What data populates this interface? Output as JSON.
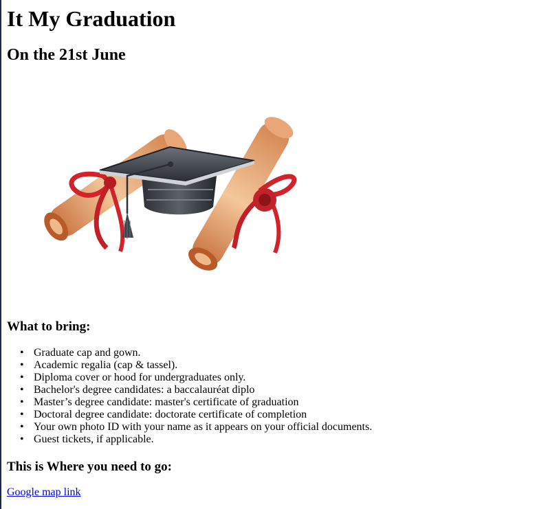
{
  "page": {
    "title": "It My Graduation",
    "date": "On the 21st June"
  },
  "hero_image": {
    "icon": "graduation-cap-diploma-illustration",
    "colors": {
      "cap": "#3b3f46",
      "scroll": "#e8a36c",
      "ribbon": "#d2232a"
    }
  },
  "bring": {
    "heading": "What to bring:",
    "items": [
      "Graduate cap and gown.",
      "Academic regalia (cap & tassel).",
      "Diploma cover or hood for undergraduates only.",
      "Bachelor's degree candidates: a baccalauréat diplo",
      "Master’s degree candidate: master's certificate of graduation",
      "Doctoral degree candidate: doctorate certificate of completion",
      "Your own photo ID with your name as it appears on your official documents.",
      "Guest tickets, if applicable."
    ]
  },
  "location": {
    "heading": "This is Where you need to go:",
    "link_text": "Google map link"
  }
}
